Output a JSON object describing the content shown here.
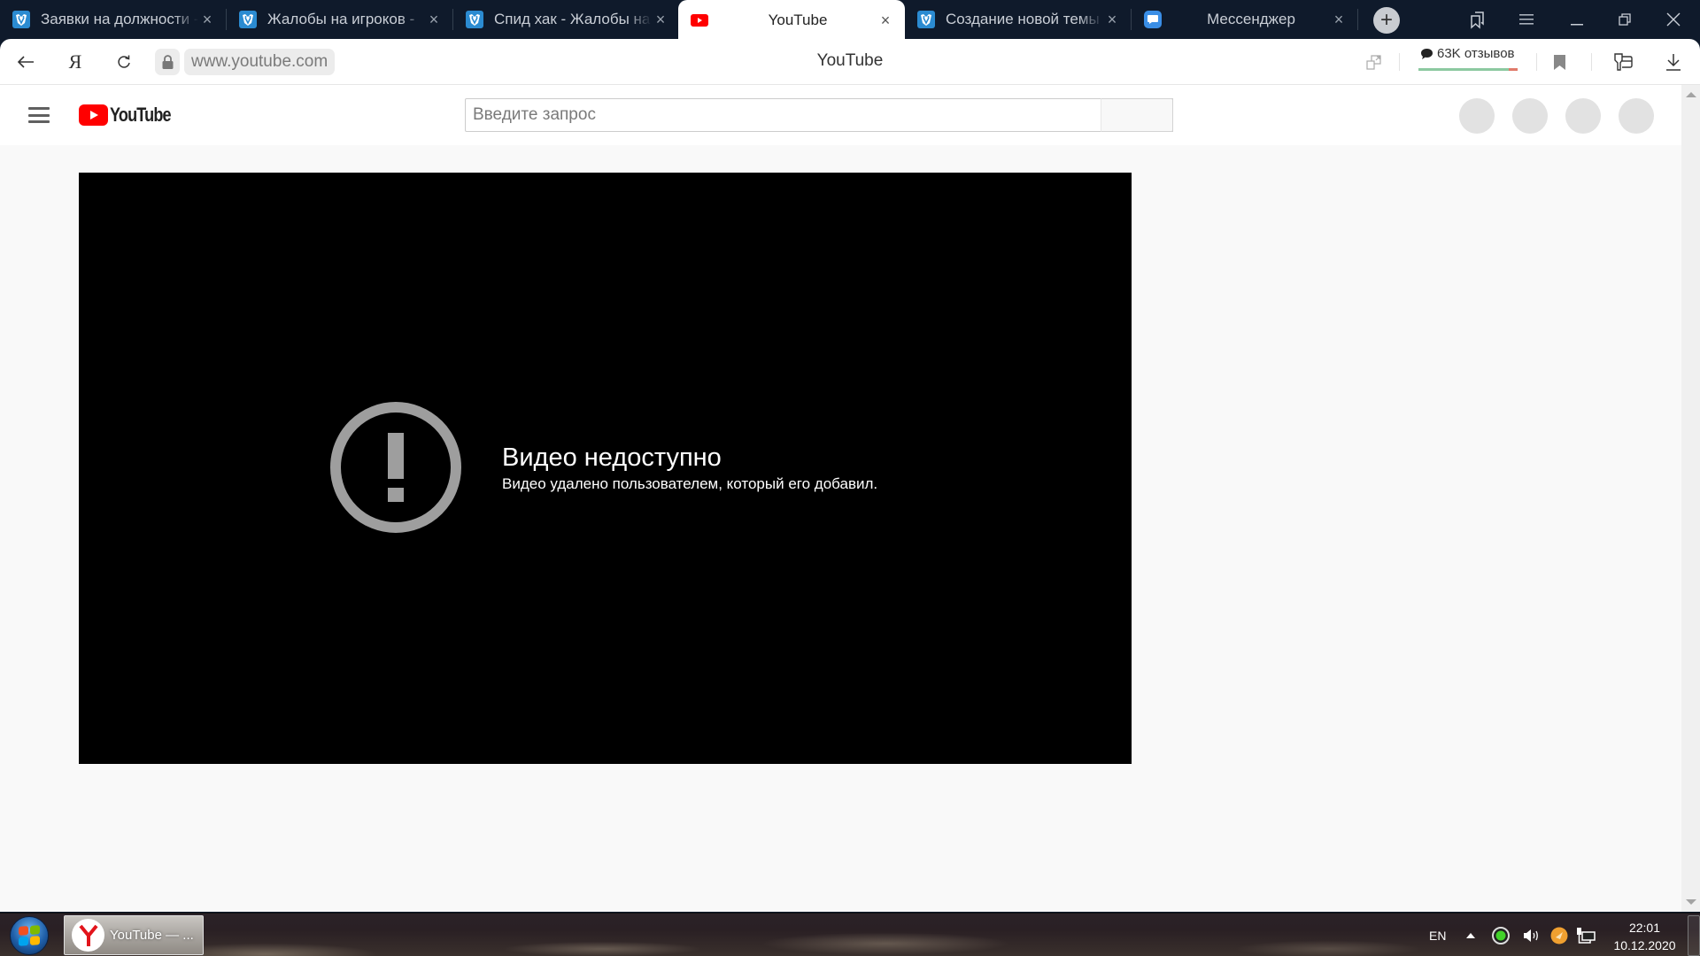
{
  "browser": {
    "tabs": [
      {
        "title": "Заявки на должности - ",
        "favicon": "forum-owl-icon",
        "active": false
      },
      {
        "title": "Жалобы на игроков - ",
        "favicon": "forum-owl-icon",
        "active": false
      },
      {
        "title": "Спид хак - Жалобы на",
        "favicon": "forum-owl-icon",
        "active": false
      },
      {
        "title": "YouTube",
        "favicon": "youtube-icon",
        "active": true
      },
      {
        "title": "Создание новой темы",
        "favicon": "forum-owl-icon",
        "active": false
      },
      {
        "title": "Мессенджер",
        "favicon": "messenger-icon",
        "active": false
      }
    ],
    "close_glyph": "×",
    "new_tab_glyph": "+",
    "window_controls": [
      "collections-icon",
      "menu-icon",
      "minimize-icon",
      "restore-icon",
      "close-icon"
    ],
    "address": {
      "url": "www.youtube.com",
      "page_title": "YouTube",
      "yandex_glyph": "Я",
      "reviews_label": "63K отзывов",
      "reviews_positive_share": 0.91
    }
  },
  "youtube": {
    "search_placeholder": "Введите запрос",
    "logo_text": "YouTube",
    "error": {
      "title": "Видео недоступно",
      "message": "Видео удалено пользователем, который его добавил."
    },
    "colors": {
      "brand_red": "#ff0000",
      "error_icon": "#9e9e9e",
      "player_bg": "#000000"
    }
  },
  "taskbar": {
    "task_label": "YouTube — ...",
    "language": "EN",
    "time": "22:01",
    "date": "10.12.2020"
  }
}
